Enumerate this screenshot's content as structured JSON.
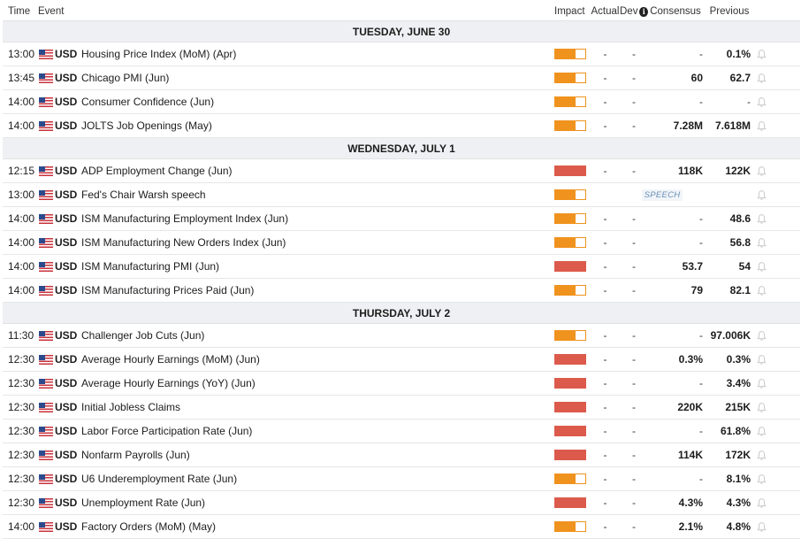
{
  "header": {
    "time": "Time",
    "event": "Event",
    "impact": "Impact",
    "actual": "Actual",
    "dev": "Dev",
    "consensus": "Consensus",
    "previous": "Previous"
  },
  "colors": {
    "medium_impact": "#f0921e",
    "high_impact": "#dc5a4b",
    "day_header_bg": "#eef0f3"
  },
  "icons": {
    "info": "info-icon",
    "bell": "bell-icon",
    "flag": "us-flag-icon"
  },
  "days": [
    {
      "label": "TUESDAY, JUNE 30",
      "events": [
        {
          "time": "13:00",
          "currency": "USD",
          "name": "Housing Price Index (MoM) (Apr)",
          "impact": "medium",
          "actual": "-",
          "dev": "-",
          "consensus": "-",
          "previous": "0.1%"
        },
        {
          "time": "13:45",
          "currency": "USD",
          "name": "Chicago PMI (Jun)",
          "impact": "medium",
          "actual": "-",
          "dev": "-",
          "consensus": "60",
          "previous": "62.7"
        },
        {
          "time": "14:00",
          "currency": "USD",
          "name": "Consumer Confidence (Jun)",
          "impact": "medium",
          "actual": "-",
          "dev": "-",
          "consensus": "-",
          "previous": "-"
        },
        {
          "time": "14:00",
          "currency": "USD",
          "name": "JOLTS Job Openings (May)",
          "impact": "medium",
          "actual": "-",
          "dev": "-",
          "consensus": "7.28M",
          "previous": "7.618M"
        }
      ]
    },
    {
      "label": "WEDNESDAY, JULY 1",
      "events": [
        {
          "time": "12:15",
          "currency": "USD",
          "name": "ADP Employment Change (Jun)",
          "impact": "high",
          "actual": "-",
          "dev": "-",
          "consensus": "118K",
          "previous": "122K"
        },
        {
          "time": "13:00",
          "currency": "USD",
          "name": "Fed's Chair Warsh speech",
          "impact": "medium",
          "speech": "SPEECH"
        },
        {
          "time": "14:00",
          "currency": "USD",
          "name": "ISM Manufacturing Employment Index (Jun)",
          "impact": "medium",
          "actual": "-",
          "dev": "-",
          "consensus": "-",
          "previous": "48.6"
        },
        {
          "time": "14:00",
          "currency": "USD",
          "name": "ISM Manufacturing New Orders Index (Jun)",
          "impact": "medium",
          "actual": "-",
          "dev": "-",
          "consensus": "-",
          "previous": "56.8"
        },
        {
          "time": "14:00",
          "currency": "USD",
          "name": "ISM Manufacturing PMI (Jun)",
          "impact": "high",
          "actual": "-",
          "dev": "-",
          "consensus": "53.7",
          "previous": "54"
        },
        {
          "time": "14:00",
          "currency": "USD",
          "name": "ISM Manufacturing Prices Paid (Jun)",
          "impact": "medium",
          "actual": "-",
          "dev": "-",
          "consensus": "79",
          "previous": "82.1"
        }
      ]
    },
    {
      "label": "THURSDAY, JULY 2",
      "events": [
        {
          "time": "11:30",
          "currency": "USD",
          "name": "Challenger Job Cuts (Jun)",
          "impact": "medium",
          "actual": "-",
          "dev": "-",
          "consensus": "-",
          "previous": "97.006K"
        },
        {
          "time": "12:30",
          "currency": "USD",
          "name": "Average Hourly Earnings (MoM) (Jun)",
          "impact": "high",
          "actual": "-",
          "dev": "-",
          "consensus": "0.3%",
          "previous": "0.3%"
        },
        {
          "time": "12:30",
          "currency": "USD",
          "name": "Average Hourly Earnings (YoY) (Jun)",
          "impact": "high",
          "actual": "-",
          "dev": "-",
          "consensus": "-",
          "previous": "3.4%"
        },
        {
          "time": "12:30",
          "currency": "USD",
          "name": "Initial Jobless Claims",
          "impact": "high",
          "actual": "-",
          "dev": "-",
          "consensus": "220K",
          "previous": "215K"
        },
        {
          "time": "12:30",
          "currency": "USD",
          "name": "Labor Force Participation Rate (Jun)",
          "impact": "high",
          "actual": "-",
          "dev": "-",
          "consensus": "-",
          "previous": "61.8%"
        },
        {
          "time": "12:30",
          "currency": "USD",
          "name": "Nonfarm Payrolls (Jun)",
          "impact": "high",
          "actual": "-",
          "dev": "-",
          "consensus": "114K",
          "previous": "172K"
        },
        {
          "time": "12:30",
          "currency": "USD",
          "name": "U6 Underemployment Rate (Jun)",
          "impact": "medium",
          "actual": "-",
          "dev": "-",
          "consensus": "-",
          "previous": "8.1%"
        },
        {
          "time": "12:30",
          "currency": "USD",
          "name": "Unemployment Rate (Jun)",
          "impact": "high",
          "actual": "-",
          "dev": "-",
          "consensus": "4.3%",
          "previous": "4.3%"
        },
        {
          "time": "14:00",
          "currency": "USD",
          "name": "Factory Orders (MoM) (May)",
          "impact": "medium",
          "actual": "-",
          "dev": "-",
          "consensus": "2.1%",
          "previous": "4.8%"
        }
      ]
    }
  ]
}
